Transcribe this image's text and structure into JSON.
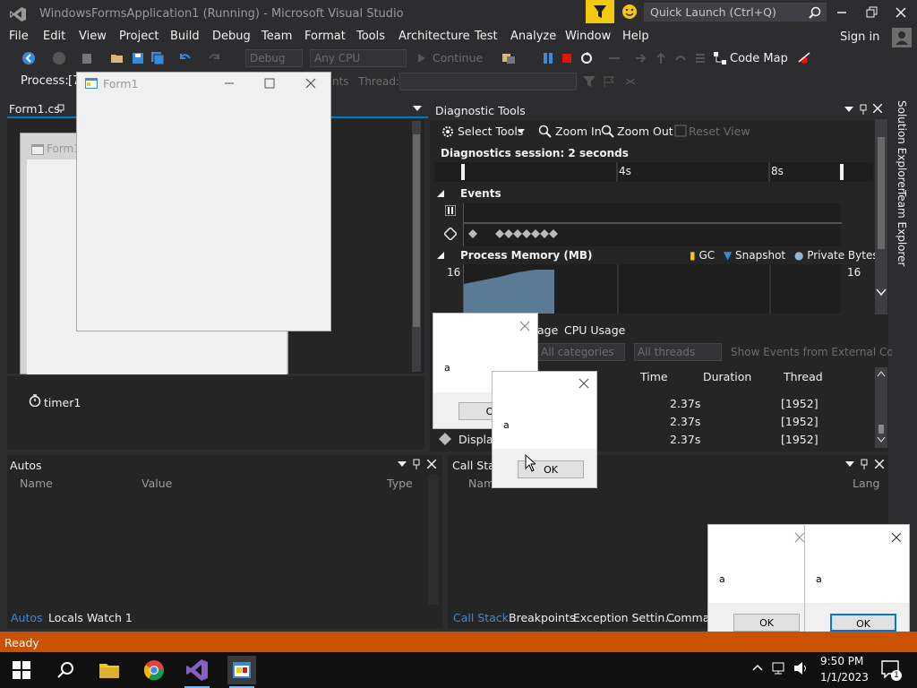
{
  "window": {
    "title": "WindowsFormsApplication1 (Running) - Microsoft Visual Studio",
    "quick_launch_placeholder": "Quick Launch (Ctrl+Q)",
    "sign_in": "Sign in"
  },
  "menu": [
    "File",
    "Edit",
    "View",
    "Project",
    "Build",
    "Debug",
    "Team",
    "Format",
    "Tools",
    "Architecture",
    "Test",
    "Analyze",
    "Window",
    "Help"
  ],
  "toolbar": {
    "config": "Debug",
    "platform": "Any CPU",
    "continue": "Continue",
    "code_map": "Code Map"
  },
  "process_bar": {
    "label": "Process:",
    "value": "[7",
    "thread_label": "Thread:",
    "partial_text": "nts"
  },
  "editor": {
    "tab": "Form1.cs",
    "designer_form_title": "Form1",
    "tray_component": "timer1"
  },
  "form1": {
    "title": "Form1"
  },
  "diagnostics": {
    "title": "Diagnostic Tools",
    "select_tools": "Select Tools",
    "zoom_in": "Zoom In",
    "zoom_out": "Zoom Out",
    "reset_view": "Reset View",
    "session": "Diagnostics session: 2 seconds",
    "ticks": [
      "4s",
      "8s"
    ],
    "events_header": "Events",
    "memory_header": "Process Memory (MB)",
    "legend": {
      "gc": "GC",
      "snapshot": "Snapshot",
      "private_bytes": "Private Bytes"
    },
    "memory_max_left": "16",
    "memory_max_right": "16",
    "lower_tab_partial": "age",
    "cpu_tab": "CPU Usage",
    "filter_categories": "All categories",
    "filter_threads": "All threads",
    "show_external": "Show Events from External Code",
    "columns": {
      "time": "Time",
      "duration": "Duration",
      "thread": "Thread"
    },
    "rows": [
      {
        "event": "",
        "time": "2.37s",
        "thread": "[1952]"
      },
      {
        "event": "",
        "time": "2.37s",
        "thread": "[1952]"
      },
      {
        "event": "Display",
        "time": "2.37s",
        "thread": "[1952]"
      }
    ]
  },
  "autos": {
    "title": "Autos",
    "columns": {
      "name": "Name",
      "value": "Value",
      "type": "Type"
    },
    "tabs": [
      "Autos",
      "Locals",
      "Watch 1"
    ]
  },
  "callstack": {
    "title": "Call Stack",
    "name_partial": "Nam",
    "lang_partial": "Lang",
    "tabs": [
      "Call Stack",
      "Breakpoints",
      "Exception Settin...",
      "Command"
    ]
  },
  "side_tabs": [
    "Solution Explorer",
    "Team Explorer"
  ],
  "message_boxes": [
    {
      "text": "a",
      "ok": "O"
    },
    {
      "text": "a",
      "ok": "OK"
    },
    {
      "text": "a",
      "ok": "OK"
    },
    {
      "text": "a",
      "ok": "OK"
    }
  ],
  "status": "Ready",
  "taskbar": {
    "time": "9:50 PM",
    "date": "1/1/2023",
    "notifications": "1"
  },
  "colors": {
    "accent": "#007acc",
    "status_bar": "#ca5100",
    "filter_button": "#f2c811"
  }
}
